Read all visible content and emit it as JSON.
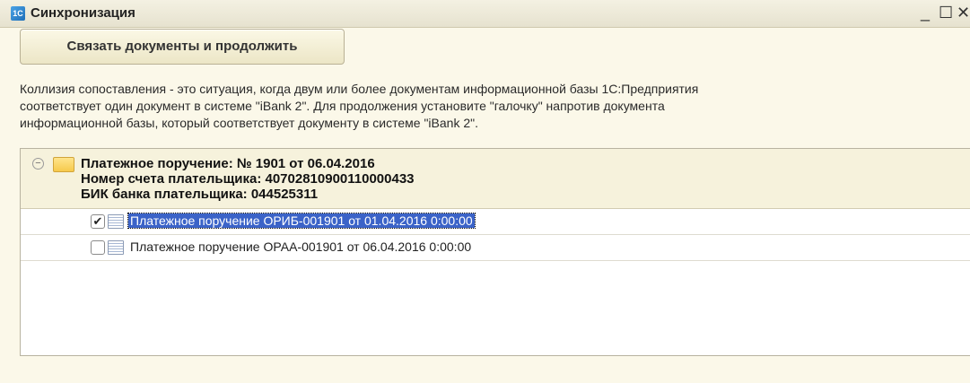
{
  "window": {
    "title": "Синхронизация",
    "minimize": "_",
    "maximize": "☐",
    "close": "✕"
  },
  "toolbar": {
    "link_button": "Связать документы и продолжить"
  },
  "description": [
    "Коллизия сопоставления - это ситуация, когда двум или более документам информационной базы 1С:Предприятия",
    "соответствует один документ в системе \"iBank 2\". Для продолжения установите \"галочку\" напротив документа",
    "информационной базы, который соответствует документу в системе \"iBank 2\"."
  ],
  "group": {
    "line1": "Платежное поручение: № 1901 от 06.04.2016",
    "line2": "Номер счета плательщика: 40702810900110000433",
    "line3": "БИК банка плательщика: 044525311"
  },
  "rows": [
    {
      "label": "Платежное поручение ОРИБ-001901 от 01.04.2016 0:00:00",
      "checked": true,
      "selected": true
    },
    {
      "label": "Платежное поручение ОРАА-001901 от 06.04.2016 0:00:00",
      "checked": false,
      "selected": false
    }
  ],
  "icons": {
    "app": "1c-app-icon",
    "group": "folder-icon",
    "row": "document-icon"
  }
}
